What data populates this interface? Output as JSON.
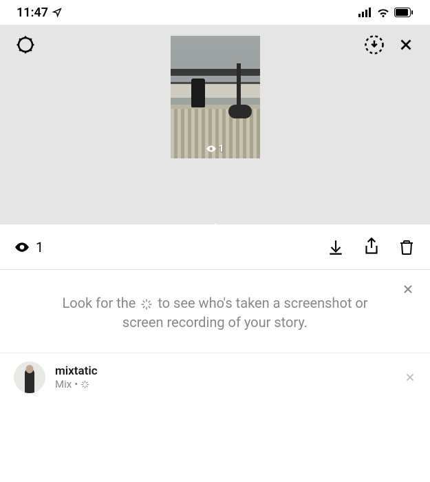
{
  "status": {
    "time": "11:47"
  },
  "story": {
    "thumb_view_count": "1"
  },
  "actionbar": {
    "view_count": "1"
  },
  "info": {
    "text_before": "Look for the",
    "text_after": "to see who's taken a screenshot or screen recording of your story."
  },
  "viewer": {
    "username": "mixtatic",
    "displayname": "Mix",
    "separator": "•"
  }
}
